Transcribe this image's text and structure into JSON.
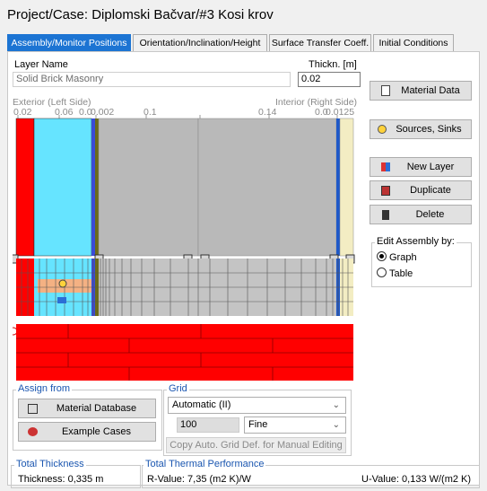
{
  "title": "Project/Case:  Diplomski Bačvar/#3 Kosi krov",
  "tabs": [
    {
      "label": "Assembly/Monitor Positions",
      "active": true
    },
    {
      "label": "Orientation/Inclination/Height",
      "active": false
    },
    {
      "label": "Surface Transfer Coeff.",
      "active": false
    },
    {
      "label": "Initial Conditions",
      "active": false
    }
  ],
  "layer": {
    "name_label": "Layer Name",
    "name_value": "Solid Brick Masonry",
    "thickness_label": "Thickn. [m]",
    "thickness_value": "0.02"
  },
  "ruler": {
    "exterior_label": "Exterior (Left Side)",
    "interior_label": "Interior (Right Side)",
    "ticks": [
      "0.02",
      "0.06",
      "0.0",
      "0.002",
      "0.1",
      "0.14",
      "0.0",
      "0.0125"
    ]
  },
  "layers_colors": [
    "#ff0000",
    "#66e4ff",
    "#3a4bd6",
    "#6b6b1a",
    "#b9b9b9",
    "#b9b9b9",
    "#1e58c8",
    "#f3edc3"
  ],
  "buttons": {
    "material_data": "Material Data",
    "sources_sinks": "Sources, Sinks",
    "new_layer": "New Layer",
    "duplicate": "Duplicate",
    "delete": "Delete"
  },
  "edit_assembly": {
    "title": "Edit Assembly by:",
    "options": [
      {
        "label": "Graph",
        "selected": true
      },
      {
        "label": "Table",
        "selected": false
      }
    ]
  },
  "assign_from": {
    "title": "Assign from",
    "material_database": "Material Database",
    "example_cases": "Example Cases"
  },
  "grid": {
    "title": "Grid",
    "mode": "Automatic (II)",
    "count": "100",
    "density": "Fine",
    "copy_button": "Copy Auto. Grid Def. for Manual Editing"
  },
  "totals": {
    "thickness_title": "Total Thickness",
    "thickness_value": "Thickness: 0,335 m",
    "thermal_title": "Total Thermal Performance",
    "r_value": "R-Value: 7,35 (m2 K)/W",
    "u_value": "U-Value: 0,133 W/(m2 K)"
  },
  "colors": {
    "accent": "#1c74d3",
    "brick": "#ff0000",
    "cyan": "#66e4ff",
    "gray": "#b9b9b9"
  }
}
